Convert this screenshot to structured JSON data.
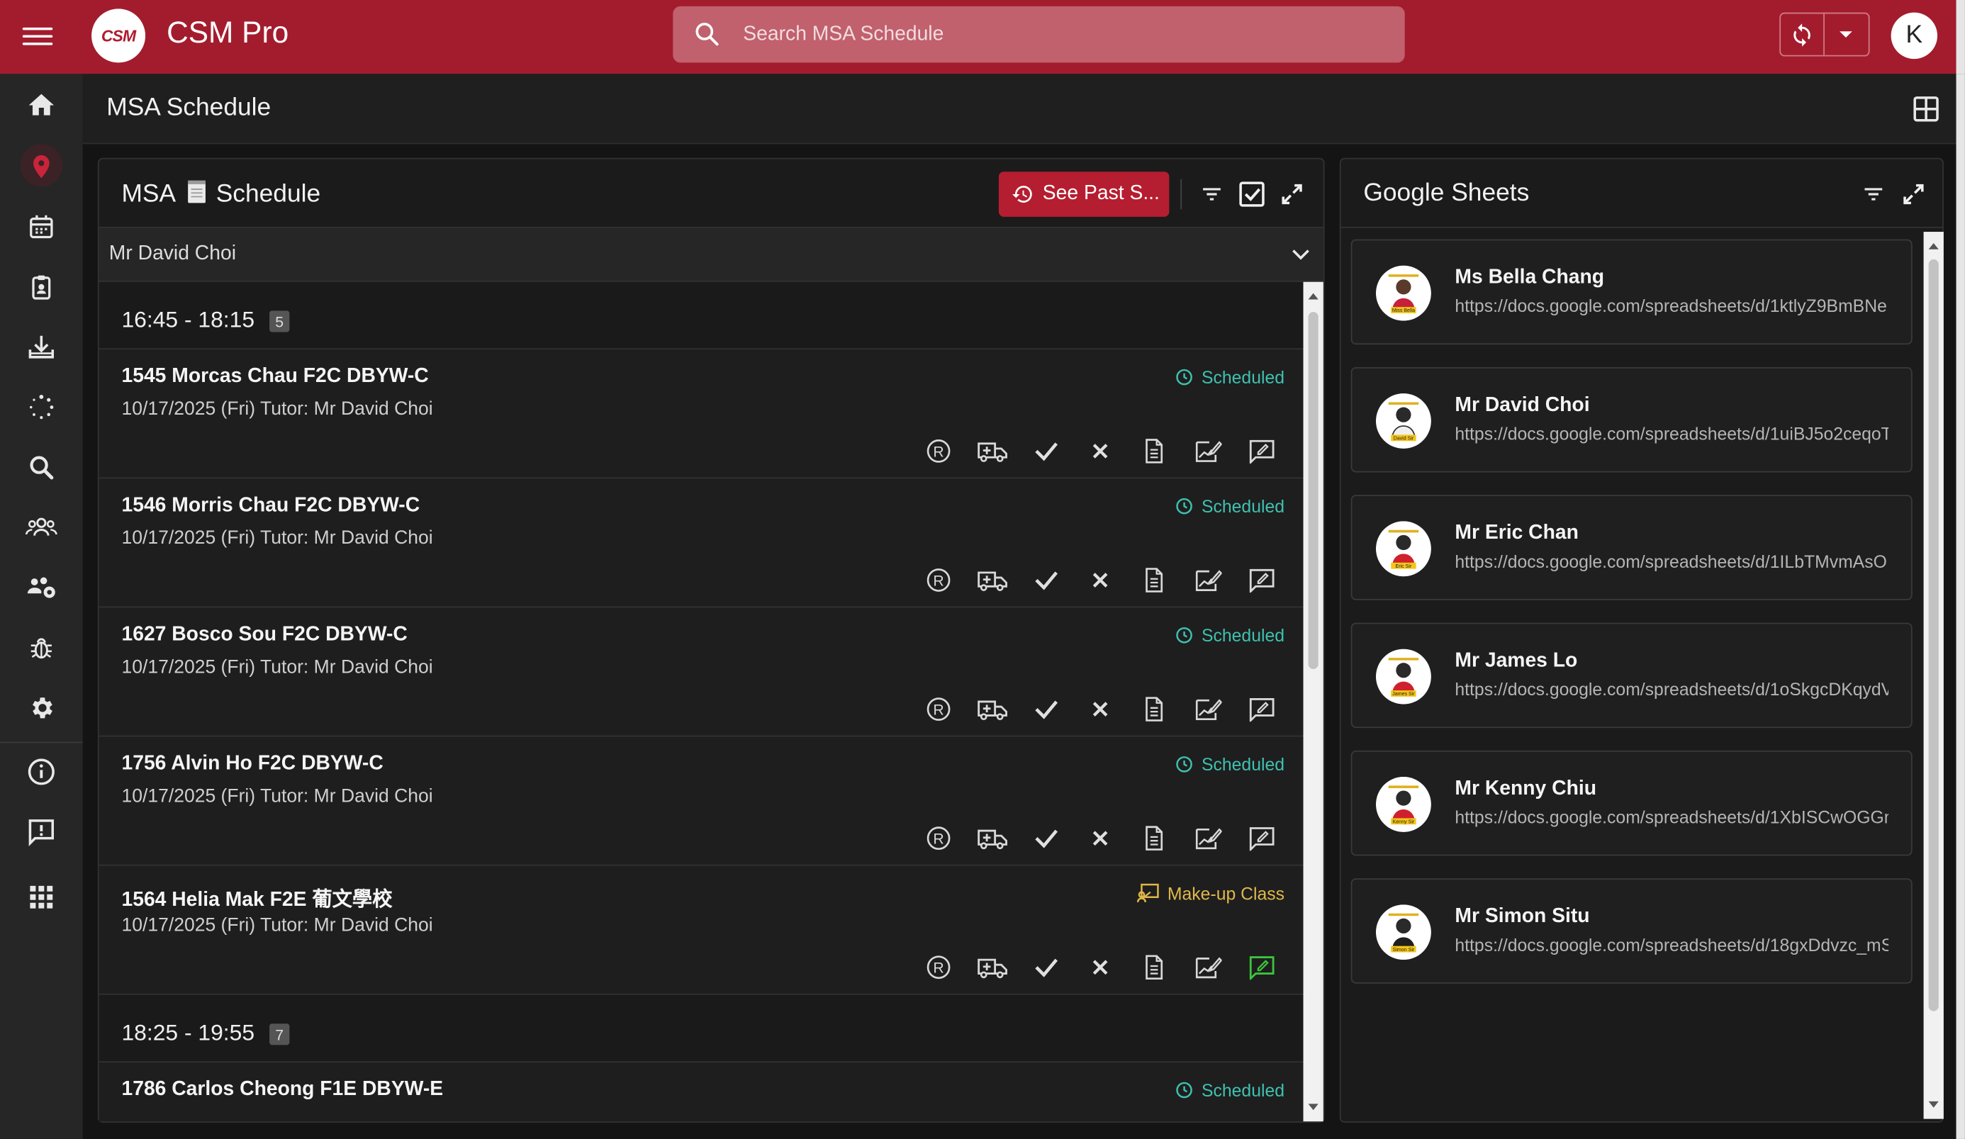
{
  "app": {
    "title": "CSM Pro",
    "logo_text": "CSM",
    "user_initial": "K"
  },
  "search": {
    "placeholder": "Search MSA Schedule"
  },
  "page": {
    "title": "MSA Schedule"
  },
  "schedule_panel": {
    "title_prefix": "MSA",
    "title_suffix": "Schedule",
    "past_button_label": "See Past S...",
    "tutor_selected": "Mr David Choi",
    "slots": [
      {
        "time": "16:45 - 18:15",
        "count": "5",
        "lessons": [
          {
            "title": "1545 Morcas Chau F2C DBYW-C",
            "subtitle": "10/17/2025 (Fri) Tutor: Mr David Choi",
            "status": "Scheduled",
            "status_type": "scheduled"
          },
          {
            "title": "1546 Morris Chau F2C DBYW-C",
            "subtitle": "10/17/2025 (Fri) Tutor: Mr David Choi",
            "status": "Scheduled",
            "status_type": "scheduled"
          },
          {
            "title": "1627 Bosco Sou F2C DBYW-C",
            "subtitle": "10/17/2025 (Fri) Tutor: Mr David Choi",
            "status": "Scheduled",
            "status_type": "scheduled"
          },
          {
            "title": "1756 Alvin Ho F2C DBYW-C",
            "subtitle": "10/17/2025 (Fri) Tutor: Mr David Choi",
            "status": "Scheduled",
            "status_type": "scheduled"
          },
          {
            "title": "1564 Helia Mak F2E 葡文學校",
            "subtitle": "10/17/2025 (Fri) Tutor: Mr David Choi",
            "status": "Make-up Class",
            "status_type": "makeup"
          }
        ]
      },
      {
        "time": "18:25 - 19:55",
        "count": "7",
        "lessons": [
          {
            "title": "1786 Carlos Cheong F1E DBYW-E",
            "subtitle": "",
            "status": "Scheduled",
            "status_type": "scheduled"
          }
        ]
      }
    ]
  },
  "sheets_panel": {
    "title": "Google Sheets",
    "items": [
      {
        "name": "Ms Bella Chang",
        "url": "https://docs.google.com/spreadsheets/d/1ktlyZ9BmBNe",
        "avatar_caption": "Miss Bella"
      },
      {
        "name": "Mr David Choi",
        "url": "https://docs.google.com/spreadsheets/d/1uiBJ5o2ceqoT",
        "avatar_caption": "David Sir"
      },
      {
        "name": "Mr Eric Chan",
        "url": "https://docs.google.com/spreadsheets/d/1ILbTMvmAsO",
        "avatar_caption": "Eric Sir"
      },
      {
        "name": "Mr James Lo",
        "url": "https://docs.google.com/spreadsheets/d/1oSkgcDKqydV",
        "avatar_caption": "James Sir"
      },
      {
        "name": "Mr Kenny Chiu",
        "url": "https://docs.google.com/spreadsheets/d/1XbISCwOGGm",
        "avatar_caption": "Kenny Sir"
      },
      {
        "name": "Mr Simon Situ",
        "url": "https://docs.google.com/spreadsheets/d/18gxDdvzc_mS",
        "avatar_caption": "Simon Sir"
      }
    ]
  },
  "colors": {
    "brand": "#a31c2e",
    "scheduled": "#3fc1b0",
    "makeup": "#e0b84a",
    "active_feedback": "#3cc43c"
  }
}
